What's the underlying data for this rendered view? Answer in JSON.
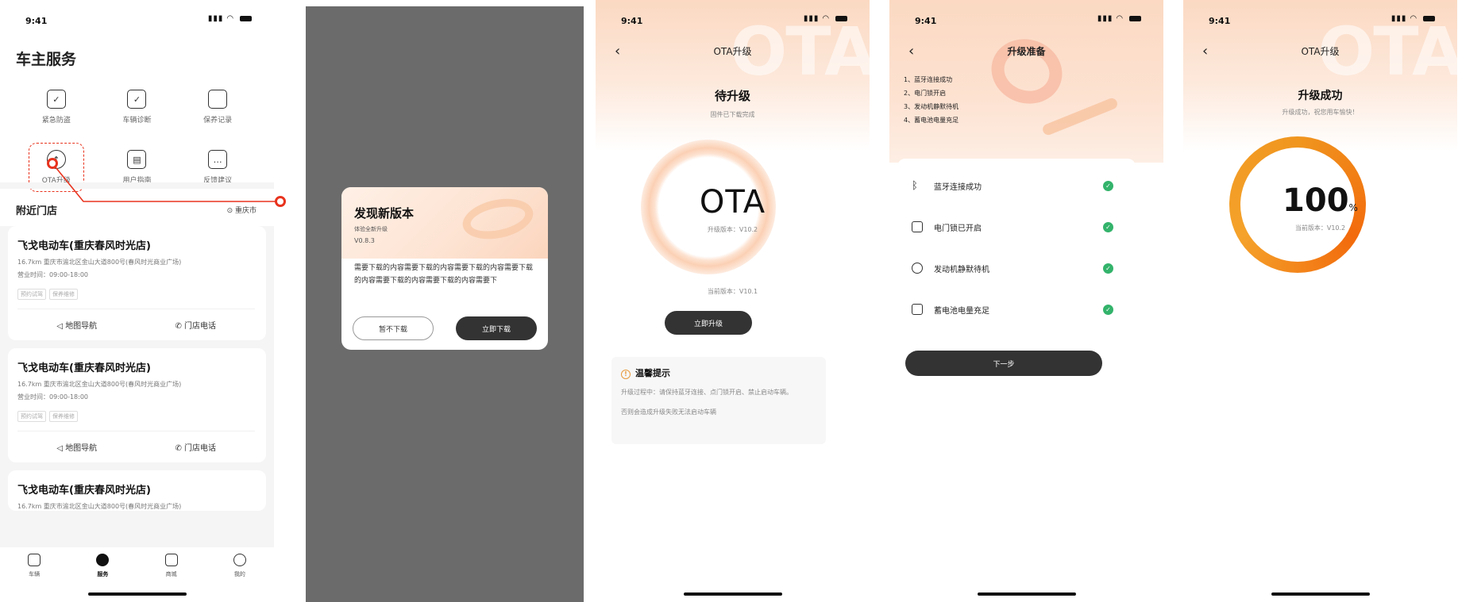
{
  "status": {
    "time": "9:41"
  },
  "screen1": {
    "title": "车主服务",
    "grid": [
      {
        "label": "紧急防盗",
        "icon": "shield-icon"
      },
      {
        "label": "车辆诊断",
        "icon": "calendar-check-icon"
      },
      {
        "label": "保养记录",
        "icon": "document-icon"
      },
      {
        "label": "OTA升级",
        "icon": "cloud-upload-icon"
      },
      {
        "label": "用户指南",
        "icon": "book-icon"
      },
      {
        "label": "反馈建议",
        "icon": "chat-icon"
      }
    ],
    "section": "附近门店",
    "location": "重庆市",
    "stores": [
      {
        "name": "飞戈电动车(重庆春风时光店)",
        "address": "16.7km   重庆市渝北区金山大道800号(春风时光商业广场)",
        "hours": "营业时间：09:00-18:00",
        "tags": [
          "预约试驾",
          "保养维修"
        ],
        "nav": "地图导航",
        "phone": "门店电话"
      },
      {
        "name": "飞戈电动车(重庆春风时光店)",
        "address": "16.7km   重庆市渝北区金山大道800号(春风时光商业广场)",
        "hours": "营业时间：09:00-18:00",
        "tags": [
          "预约试驾",
          "保养维修"
        ],
        "nav": "地图导航",
        "phone": "门店电话"
      },
      {
        "name": "飞戈电动车(重庆春风时光店)",
        "address": "16.7km   重庆市渝北区金山大道800号(春风时光商业广场)",
        "hours": "",
        "tags": [],
        "nav": "",
        "phone": ""
      }
    ],
    "tabs": [
      {
        "label": "车辆"
      },
      {
        "label": "服务"
      },
      {
        "label": "商城"
      },
      {
        "label": "我的"
      }
    ]
  },
  "screen2": {
    "title": "发现新版本",
    "subtitle": "体验全新升级",
    "version": "V0.8.3",
    "body": "需要下载的内容需要下载的内容需要下载的内容需要下载的内容需要下载的内容需要下载的内容需要下",
    "btn_later": "暂不下载",
    "btn_now": "立即下载"
  },
  "screen3": {
    "nav_title": "OTA升级",
    "state": "待升级",
    "state_sub": "固件已下载完成",
    "ota_text": "OTA",
    "upgrade_version": "升级版本：V10.2",
    "current_version": "当前版本：V10.1",
    "upgrade_btn": "立即升级",
    "tips_title": "温馨提示",
    "tips_text": "升级过程中：请保持蓝牙连接、点门锁开启、禁止启动车辆。",
    "tips_text2": "否则会造成升级失败无法启动车辆",
    "watermark": "OTA"
  },
  "screen4": {
    "nav_title": "升级准备",
    "steps": [
      "1、蓝牙连接成功",
      "2、电门锁开启",
      "3、发动机静默待机",
      "4、蓄电池电量充足"
    ],
    "checks": [
      {
        "label": "蓝牙连接成功",
        "icon": "bluetooth-icon"
      },
      {
        "label": "电门锁已开启",
        "icon": "lock-icon"
      },
      {
        "label": "发动机静默待机",
        "icon": "engine-icon"
      },
      {
        "label": "蓄电池电量充足",
        "icon": "battery-icon"
      }
    ],
    "next_btn": "下一步"
  },
  "screen5": {
    "nav_title": "OTA升级",
    "state": "升级成功",
    "state_sub": "升级成功，祝您用车愉快！",
    "percent": "100",
    "percent_unit": "%",
    "current_version": "当前版本：V10.2",
    "watermark": "OTA"
  }
}
